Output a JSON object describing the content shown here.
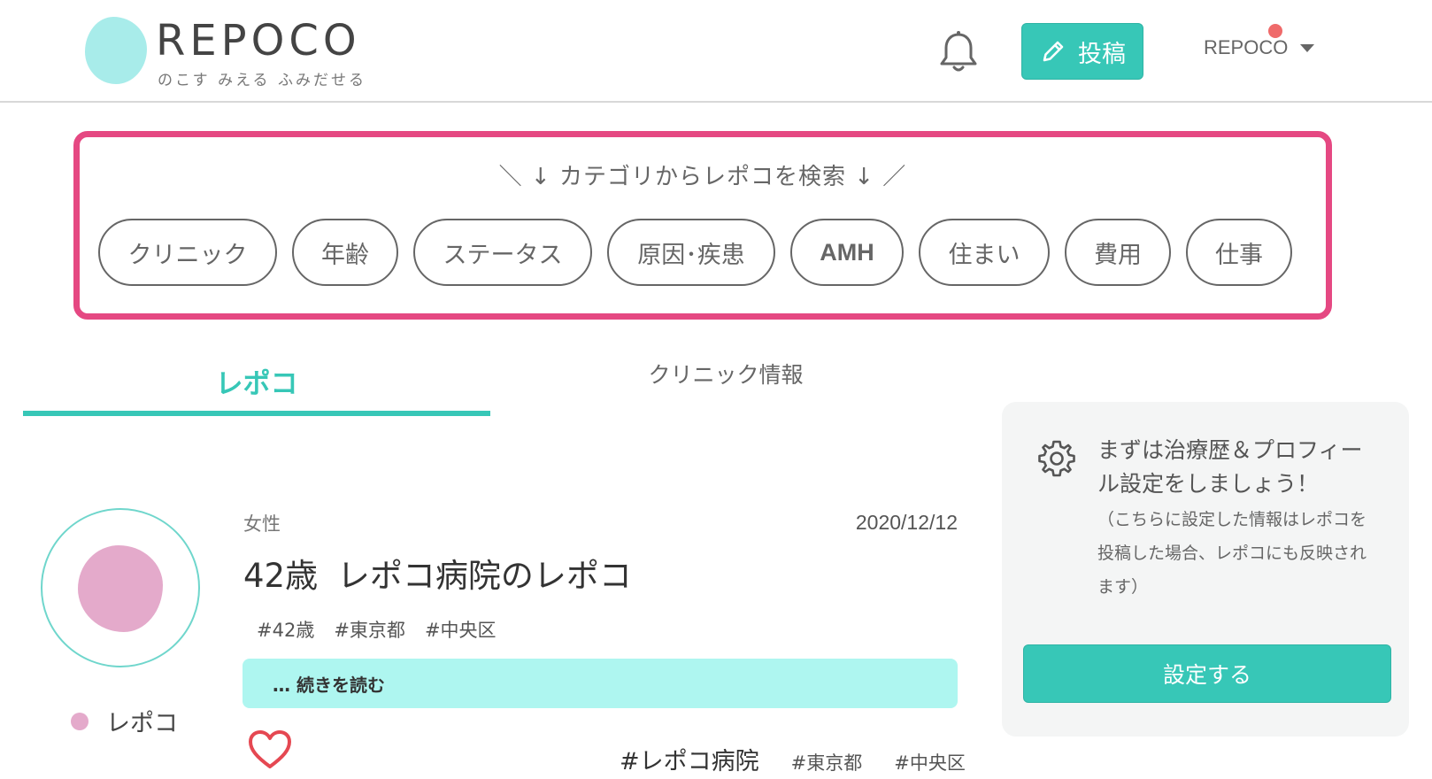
{
  "header": {
    "logo_text": "REPOCO",
    "logo_tagline": "のこす みえる ふみだせる",
    "post_button_label": "投稿",
    "user_name": "REPOCO",
    "notification_dot_color": "#ef6a6a",
    "icons": {
      "bell": "bell-icon",
      "pencil": "pencil-icon",
      "caret": "chevron-down-icon"
    }
  },
  "category_search": {
    "heading": "＼ ↓ カテゴリからレポコを検索 ↓ ／",
    "border_color": "#e54882",
    "categories": [
      "クリニック",
      "年齢",
      "ステータス",
      "原因･疾患",
      "AMH",
      "住まい",
      "費用",
      "仕事"
    ]
  },
  "tabs": [
    {
      "label": "レポコ",
      "active": true
    },
    {
      "label": "クリニック情報",
      "active": false
    }
  ],
  "accent_color": "#37c7b7",
  "sidebar": {
    "title": "まずは治療歴＆プロフィール設定をしましょう！",
    "note": "（こちらに設定した情報はレポコを投稿した場合、レポコにも反映されます）",
    "button_label": "設定する",
    "icon": "gear-icon"
  },
  "post": {
    "author_name": "レポコ",
    "gender": "女性",
    "date": "2020/12/12",
    "title": "42歳 レポコ病院のレポコ",
    "tags": [
      "#42歳",
      "#東京都",
      "#中央区"
    ],
    "read_more_label": "… 続きを読む",
    "clinic_tag": "#レポコ病院",
    "location_tags": [
      "#東京都",
      "#中央区"
    ],
    "icon": "heart-icon"
  }
}
